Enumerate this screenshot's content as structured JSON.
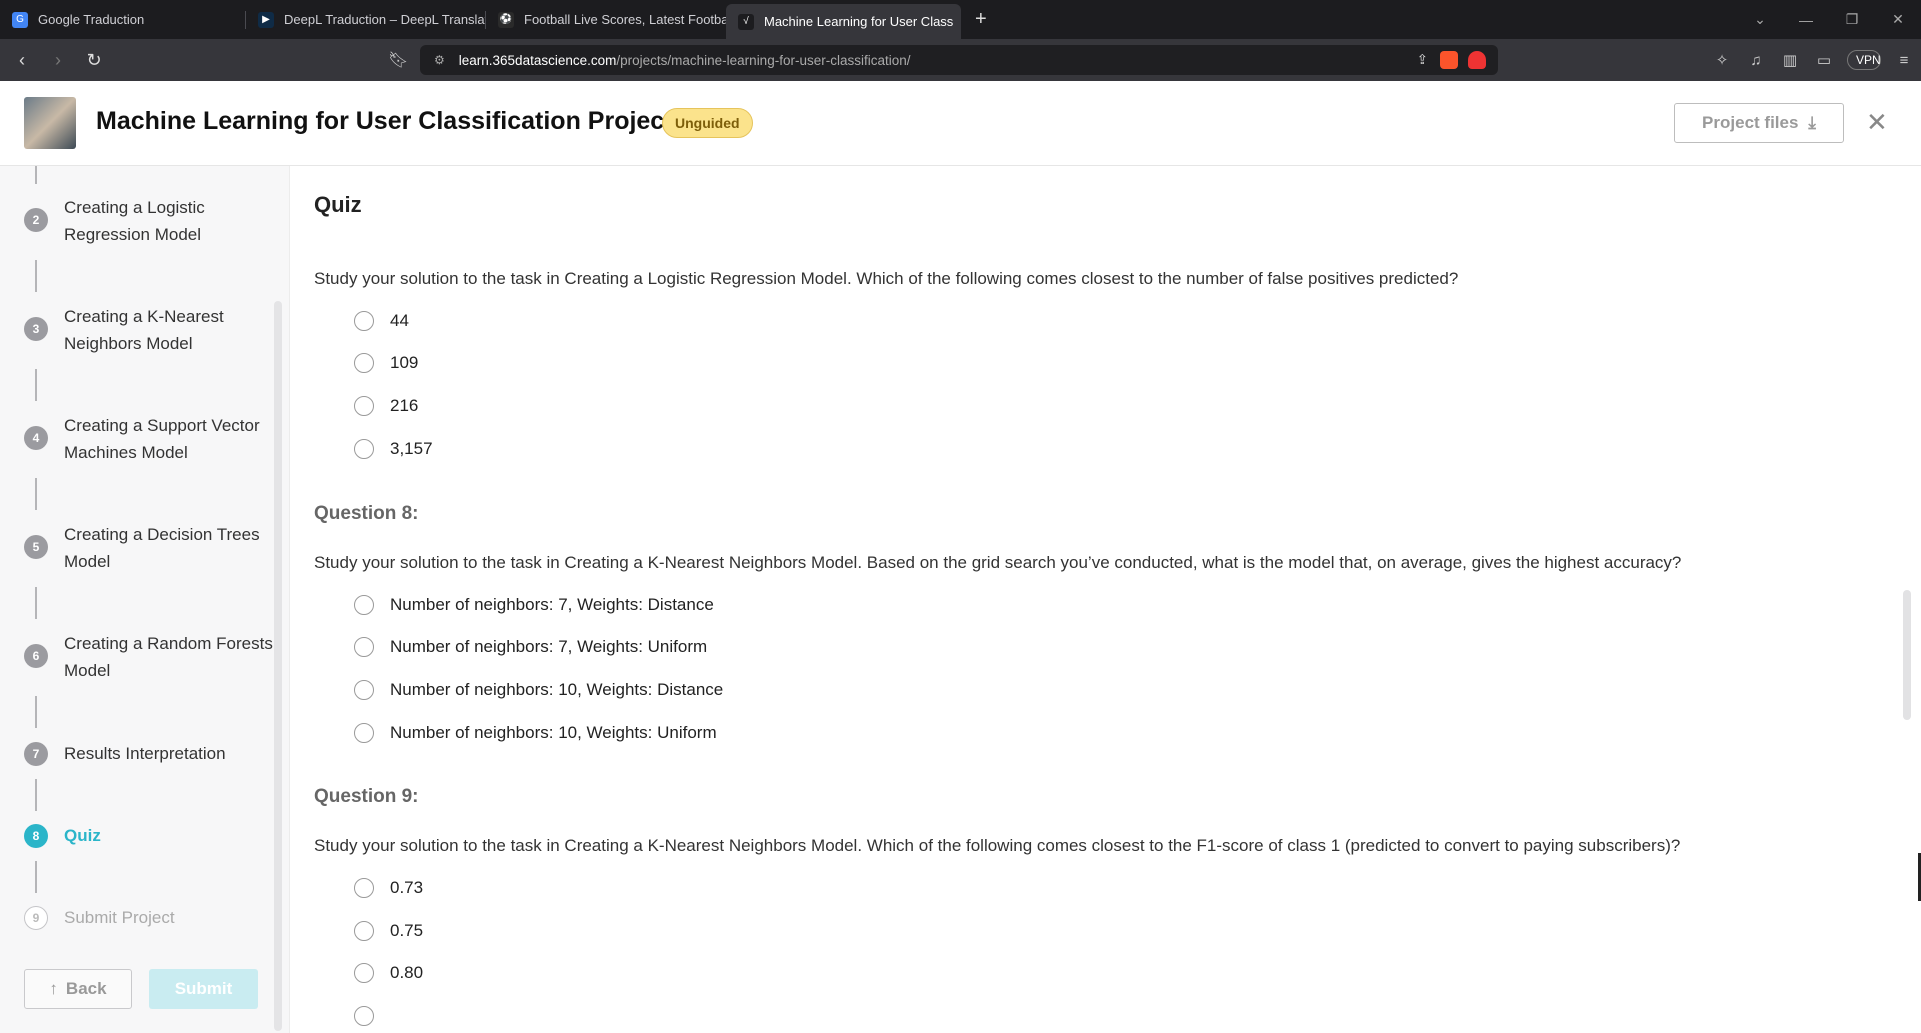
{
  "browser": {
    "tabs": [
      {
        "title": "Google Traduction",
        "fav_color": "#4285f4"
      },
      {
        "title": "DeepL Traduction – DeepL Translate",
        "fav_color": "#0f2b46"
      },
      {
        "title": "Football Live Scores, Latest Football",
        "fav_color": "#2a2a2a"
      },
      {
        "title": "Machine Learning for User Class",
        "fav_color": "#1c1c1f"
      }
    ],
    "url_host": "learn.365datascience.com",
    "url_path": "/projects/machine-learning-for-user-classification/",
    "vpn_label": "VPN"
  },
  "header": {
    "title": "Machine Learning for User Classification Project",
    "badge": "Unguided",
    "project_files_label": "Project files"
  },
  "sidebar": {
    "steps": [
      {
        "num": "2",
        "label": "Creating a Logistic Regression Model",
        "state": "done"
      },
      {
        "num": "3",
        "label": "Creating a K-Nearest Neighbors Model",
        "state": "done"
      },
      {
        "num": "4",
        "label": "Creating a Support Vector Machines Model",
        "state": "done"
      },
      {
        "num": "5",
        "label": "Creating a Decision Trees Model",
        "state": "done"
      },
      {
        "num": "6",
        "label": "Creating a Random Forests Model",
        "state": "done"
      },
      {
        "num": "7",
        "label": "Results Interpretation",
        "state": "done"
      },
      {
        "num": "8",
        "label": "Quiz",
        "state": "active"
      },
      {
        "num": "9",
        "label": "Submit Project",
        "state": "pending"
      }
    ],
    "back_label": "Back",
    "submit_label": "Submit"
  },
  "main": {
    "title": "Quiz",
    "q7": {
      "text": "Study your solution to the task in Creating a Logistic Regression Model. Which of the following comes closest to the number of false positives predicted?",
      "options": [
        "44",
        "109",
        "216",
        "3,157"
      ]
    },
    "q8": {
      "heading": "Question 8:",
      "text": "Study your solution to the task in Creating a K-Nearest Neighbors Model. Based on the grid search you’ve conducted, what is the model that, on average, gives the highest accuracy?",
      "options": [
        "Number of neighbors: 7, Weights: Distance",
        "Number of neighbors: 7, Weights: Uniform",
        "Number of neighbors: 10, Weights: Distance",
        "Number of neighbors: 10, Weights: Uniform"
      ]
    },
    "q9": {
      "heading": "Question 9:",
      "text": "Study your solution to the task in Creating a K-Nearest Neighbors Model. Which of the following comes closest to the F1-score of class 1 (predicted to convert to paying subscribers)?",
      "options": [
        "0.73",
        "0.75",
        "0.80"
      ]
    }
  }
}
